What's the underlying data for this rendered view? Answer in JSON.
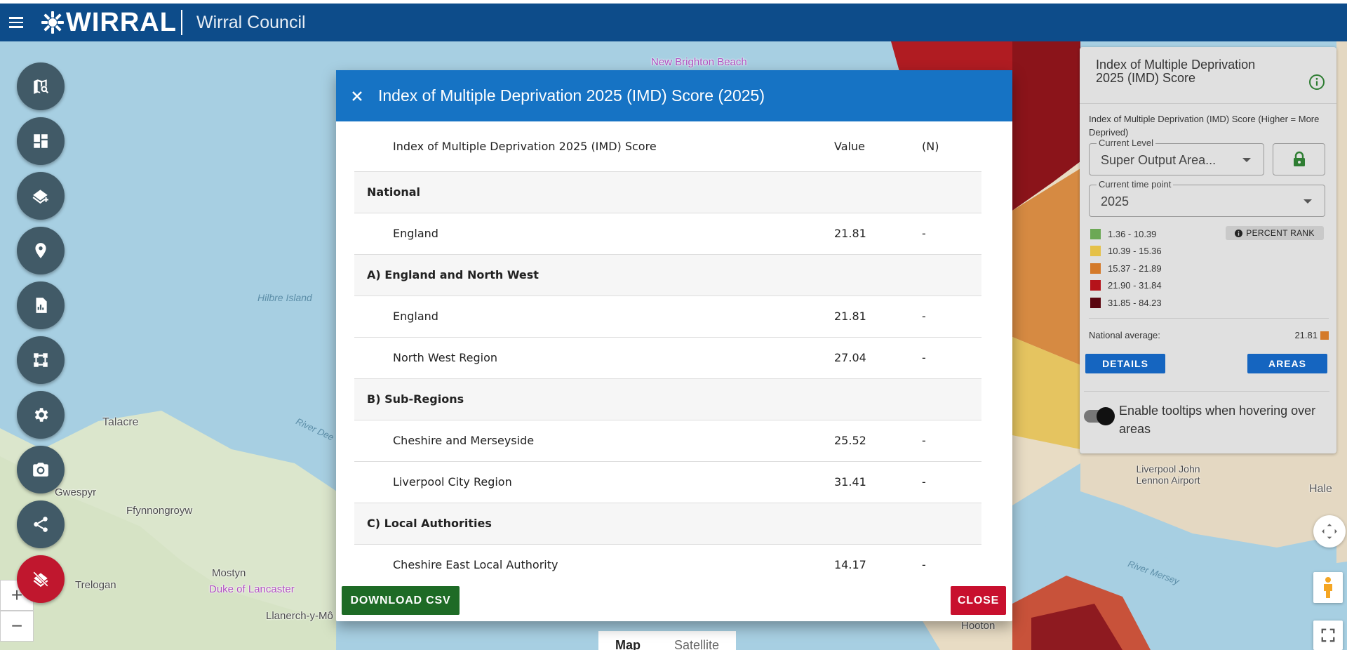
{
  "header": {
    "brand": "WIRRAL",
    "subtitle": "Wirral Council"
  },
  "map": {
    "labels": [
      {
        "text": "New Brighton Beach",
        "kind": "poi"
      },
      {
        "text": "Hilbre Island",
        "kind": "water"
      },
      {
        "text": "Talacre",
        "kind": "town"
      },
      {
        "text": "River Dee",
        "kind": "water"
      },
      {
        "text": "Gwespyr",
        "kind": "town"
      },
      {
        "text": "Ffynnongroyw",
        "kind": "town"
      },
      {
        "text": "Mostyn",
        "kind": "town"
      },
      {
        "text": "Duke of Lancaster",
        "kind": "poi"
      },
      {
        "text": "Trelogan",
        "kind": "town"
      },
      {
        "text": "Llanerch-y-Mô",
        "kind": "town"
      },
      {
        "text": "Liverpool John Lennon Airport",
        "kind": "poi"
      },
      {
        "text": "Hale",
        "kind": "town"
      },
      {
        "text": "River Mersey",
        "kind": "water"
      },
      {
        "text": "Hooton",
        "kind": "town"
      }
    ],
    "map_type": {
      "map": "Map",
      "satellite": "Satellite"
    },
    "zoom": {
      "in": "+",
      "out": "−"
    }
  },
  "toolbar": {
    "icons": [
      "map-search-icon",
      "dashboard-icon",
      "layers-add-icon",
      "location-pin-icon",
      "report-chart-icon",
      "hierarchy-icon",
      "settings-icon",
      "camera-icon",
      "share-icon",
      "layers-off-icon"
    ]
  },
  "legend": {
    "title": "Index of Multiple Deprivation 2025 (IMD) Score",
    "description": "Index of Multiple Deprivation (IMD) Score (Higher = More Deprived)",
    "current_level_label": "Current Level",
    "current_level_value": "Super Output Area...",
    "time_point_label": "Current time point",
    "time_point_value": "2025",
    "rank_badge": "PERCENT RANK",
    "bands": [
      {
        "range": "1.36 - 10.39",
        "color": "#6ca855"
      },
      {
        "range": "10.39 - 15.36",
        "color": "#e5c148"
      },
      {
        "range": "15.37 - 21.89",
        "color": "#d47a2a"
      },
      {
        "range": "21.90 - 31.84",
        "color": "#b5131a"
      },
      {
        "range": "31.85 - 84.23",
        "color": "#5a0610"
      }
    ],
    "national_average_label": "National average:",
    "national_average_value": "21.81",
    "details_button": "DETAILS",
    "areas_button": "AREAS",
    "tooltip_toggle_label": "Enable tooltips when hovering over areas"
  },
  "modal": {
    "title": "Index of Multiple Deprivation 2025 (IMD) Score (2025)",
    "columns": [
      "Index of Multiple Deprivation 2025 (IMD) Score",
      "Value",
      "(N)"
    ],
    "rows": [
      {
        "type": "section",
        "label": "National"
      },
      {
        "type": "item",
        "label": "England",
        "value": "21.81",
        "n": "-"
      },
      {
        "type": "section",
        "label": "A) England and North West"
      },
      {
        "type": "item",
        "label": "England",
        "value": "21.81",
        "n": "-"
      },
      {
        "type": "item",
        "label": "North West Region",
        "value": "27.04",
        "n": "-"
      },
      {
        "type": "section",
        "label": "B) Sub-Regions"
      },
      {
        "type": "item",
        "label": "Cheshire and Merseyside",
        "value": "25.52",
        "n": "-"
      },
      {
        "type": "item",
        "label": "Liverpool City Region",
        "value": "31.41",
        "n": "-"
      },
      {
        "type": "section",
        "label": "C) Local Authorities"
      },
      {
        "type": "item",
        "label": "Cheshire East Local Authority",
        "value": "14.17",
        "n": "-"
      }
    ],
    "download_button": "DOWNLOAD CSV",
    "close_button": "CLOSE"
  }
}
